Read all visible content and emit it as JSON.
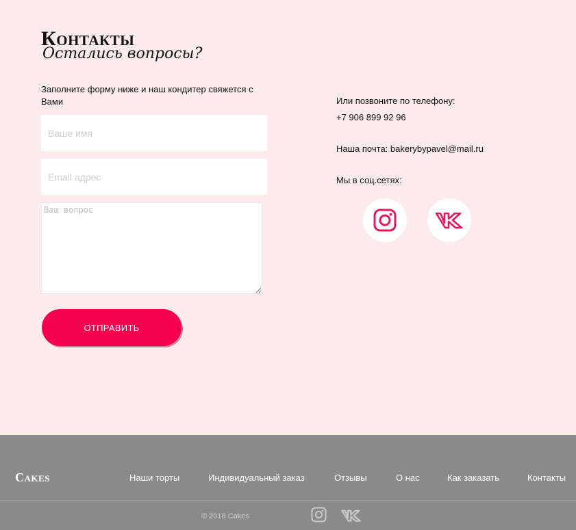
{
  "contacts": {
    "title": "Контакты",
    "subtitle": "Остались вопросы?",
    "form_intro": "Заполните форму ниже и наш кондитер свяжется с Вами",
    "name_placeholder": "Ваше имя",
    "email_placeholder": "Email адрес",
    "question_placeholder": "Ваш вопрос",
    "submit_label": "ОТПРАВИТЬ",
    "phone_label": "Или позвоните по телефону:",
    "phone_value": "+7 906 899 92 96",
    "email_line": "Наша почта: bakerybypavel@mail.ru",
    "social_label": "Мы в соц.сетях:",
    "social_icons": [
      "instagram-icon",
      "vk-icon"
    ]
  },
  "footer": {
    "logo": "Cakes",
    "nav": [
      "Наши торты",
      "Индивидуальный заказ",
      "Отзывы",
      "О нас",
      "Как заказать",
      "Контакты"
    ],
    "copyright": "© 2018 Cakes"
  },
  "colors": {
    "accent": "#f5004f",
    "icon": "#e0195a",
    "background": "#fbebea",
    "footer": "#8a8a8a"
  }
}
